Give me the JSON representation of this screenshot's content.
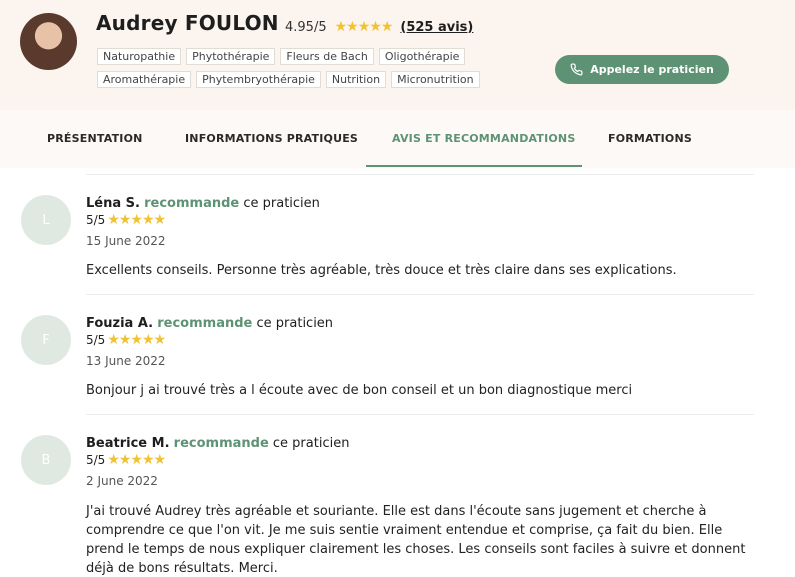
{
  "practitioner": {
    "name": "Audrey FOULON",
    "rating": "4.95/5",
    "stars": "★★★★★",
    "review_count": "(525 avis)",
    "tags_row1": [
      "Naturopathie",
      "Phytothérapie",
      "Fleurs de Bach",
      "Oligothérapie"
    ],
    "tags_row2": [
      "Aromathérapie",
      "Phytembryothérapie",
      "Nutrition",
      "Micronutrition"
    ],
    "call_label": "Appelez le praticien"
  },
  "tabs": [
    {
      "label": "PRÉSENTATION",
      "active": false
    },
    {
      "label": "INFORMATIONS PRATIQUES",
      "active": false
    },
    {
      "label": "AVIS ET RECOMMANDATIONS",
      "active": true
    },
    {
      "label": "FORMATIONS",
      "active": false
    }
  ],
  "reviews": [
    {
      "initial": "L",
      "author": "Léna S.",
      "verb": "recommande",
      "suffix": "ce praticien",
      "score": "5/5",
      "stars": "★★★★★",
      "date": "15 June 2022",
      "text": "Excellents conseils.  Personne très agréable, très douce et très claire dans ses explications."
    },
    {
      "initial": "F",
      "author": "Fouzia A.",
      "verb": "recommande",
      "suffix": "ce praticien",
      "score": "5/5",
      "stars": "★★★★★",
      "date": "13 June 2022",
      "text": "Bonjour j ai trouvé très a l écoute avec de bon conseil et un bon diagnostique merci"
    },
    {
      "initial": "B",
      "author": "Beatrice M.",
      "verb": "recommande",
      "suffix": "ce praticien",
      "score": "5/5",
      "stars": "★★★★★",
      "date": "2 June 2022",
      "text": "J'ai trouvé Audrey très agréable et souriante. Elle est dans l'écoute sans jugement et cherche à comprendre ce que l'on vit. Je me suis sentie vraiment entendue et comprise, ça fait du bien. Elle prend le temps de nous expliquer clairement les choses. Les conseils sont faciles à suivre et donnent déjà de bons résultats. Merci."
    }
  ],
  "colors": {
    "accent": "#5e9274",
    "star": "#f1c232",
    "header_bg": "#fbf4ef"
  }
}
